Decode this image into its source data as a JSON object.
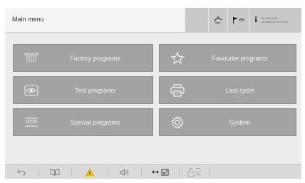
{
  "header": {
    "title": "Main menu"
  },
  "status": {
    "language": "en",
    "datetime_line1": "09 / 2021 09",
    "datetime_line2": "04/05/2022 10:03:26"
  },
  "menu": {
    "factory_programs": "Factory programs",
    "favourite_programs": "Favourite programs",
    "test_programs": "Test programs",
    "last_cycle": "Last cycle",
    "special_programs": "Special programs",
    "system": "System"
  },
  "icons": {
    "status": [
      "hand-wash-icon",
      "flag-icon",
      "info-icon"
    ],
    "tiles": [
      "factory-programs-icon",
      "star-icon",
      "eye-icon",
      "printer-icon",
      "special-programs-icon",
      "gear-icon"
    ],
    "bottom": [
      "back-icon",
      "book-icon",
      "warning-icon",
      "volume-icon",
      "door-lock-icon",
      "unlock-icon"
    ]
  },
  "colors": {
    "tile_bg": "#a3a3a3",
    "tile_text": "#f2f2f2",
    "warning": "#f0c000",
    "status_bg": "#c9c9c9"
  }
}
